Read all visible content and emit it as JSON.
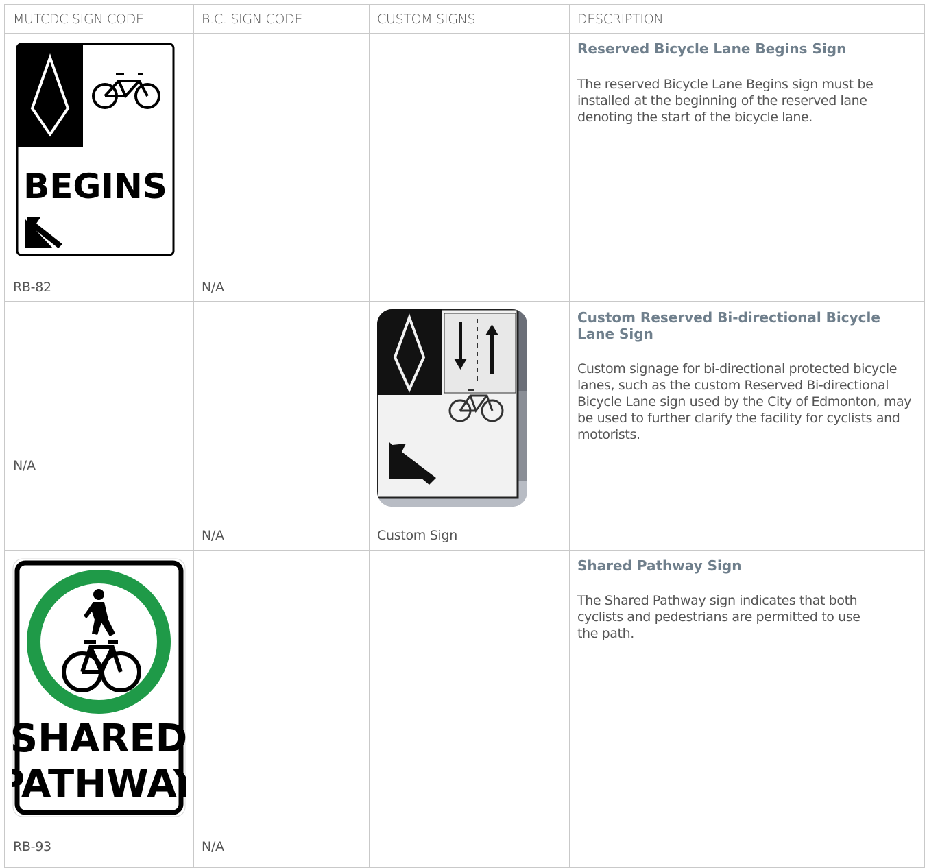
{
  "headers": [
    "MUTCDC SIGN CODE",
    "B.C. SIGN CODE",
    "CUSTOM SIGNS",
    "DESCRIPTION"
  ],
  "rows": [
    {
      "mutcdc_code": "RB-82",
      "bc_code": "N/A",
      "custom": "",
      "title": "Reserved Bicycle Lane Begins Sign",
      "body": "The reserved Bicycle Lane Begins sign must be installed at the beginning of the reserved lane denoting the start of the bicycle lane.",
      "sign_text": "BEGINS"
    },
    {
      "mutcdc_code": "N/A",
      "bc_code": "N/A",
      "custom": "Custom Sign",
      "title": "Custom Reserved Bi-directional Bicycle Lane Sign",
      "body": "Custom signage for bi-directional protected bicycle lanes, such as the custom Reserved Bi-directional Bicycle Lane sign used by the City of Edmonton, may be used to further clarify the facility for cyclists and motorists."
    },
    {
      "mutcdc_code": "RB-93",
      "bc_code": "N/A",
      "custom": "",
      "title": "Shared Pathway Sign",
      "body": "The Shared Pathway sign indicates that both cyclists and pedestrians are permitted to use the path.",
      "sign_text_1": "SHARED",
      "sign_text_2": "PATHWAY"
    }
  ],
  "colors": {
    "grid": "#c9c9c9",
    "title": "#6f7f8c",
    "sign_green": "#1f9a48"
  }
}
